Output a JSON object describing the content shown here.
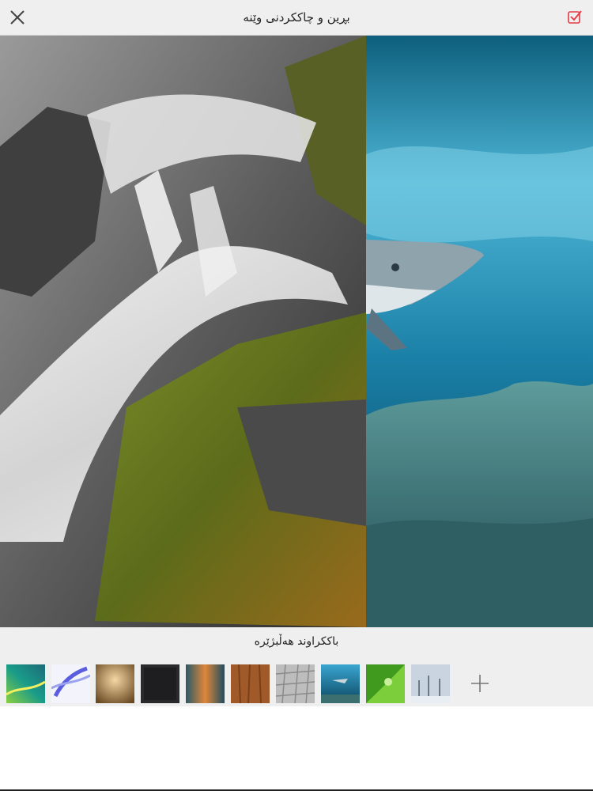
{
  "header": {
    "title": "بڕین و چاککردنی وێنە",
    "close_icon": "close-icon",
    "confirm_icon": "checkbox-check-icon",
    "accent_color": "#e53945"
  },
  "canvas": {
    "left_image": "waterfall-mossy-rocks",
    "right_image": "shark-coral-reef-underwater"
  },
  "background_picker": {
    "label": "باككراوند هەڵبژێرە",
    "thumbnails": [
      "green-teal-gradient",
      "blue-feathers",
      "gold-bokeh",
      "dark-texture",
      "teal-orange-blur",
      "wood-grain",
      "cobblestone",
      "underwater-shark",
      "green-leaf-droplet",
      "winter-trees"
    ],
    "add_icon": "plus-icon"
  }
}
